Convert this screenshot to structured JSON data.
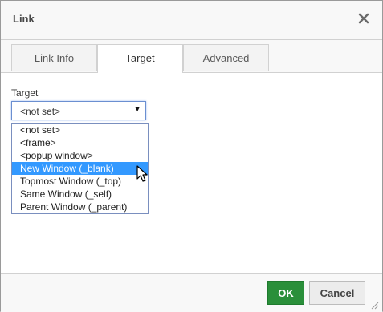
{
  "dialog": {
    "title": "Link"
  },
  "tabs": [
    {
      "label": "Link Info"
    },
    {
      "label": "Target"
    },
    {
      "label": "Advanced"
    }
  ],
  "target": {
    "label": "Target",
    "selected_value": "<not set>",
    "options": [
      "<not set>",
      "<frame>",
      "<popup window>",
      "New Window (_blank)",
      "Topmost Window (_top)",
      "Same Window (_self)",
      "Parent Window (_parent)"
    ],
    "highlighted_option": "New Window (_blank)"
  },
  "footer": {
    "ok_label": "OK",
    "cancel_label": "Cancel"
  },
  "colors": {
    "ok": "#2a8f3a",
    "highlight": "#3399ff"
  },
  "icons": {
    "close": "close-icon",
    "dropdown": "dropdown-arrow-icon",
    "cursor": "mouse-pointer-icon",
    "resize": "resize-grip-icon"
  }
}
